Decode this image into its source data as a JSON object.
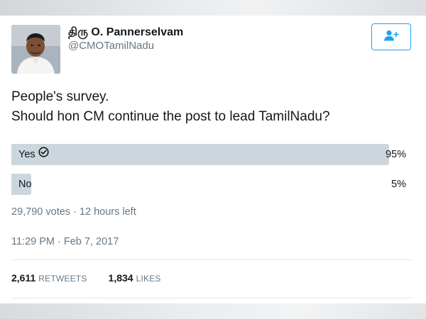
{
  "user": {
    "display_name": "திரு O. Pannerselvam",
    "handle": "@CMOTamilNadu",
    "avatar_icon": "profile-photo"
  },
  "follow_button": {
    "icon": "add-user-icon",
    "accent": "#1da1f2"
  },
  "tweet": {
    "line1": "People's survey.",
    "line2": "Should hon CM continue the post to lead TamilNadu?"
  },
  "poll": {
    "options": [
      {
        "label": "Yes",
        "percent_text": "95%",
        "percent": 95,
        "selected": true
      },
      {
        "label": "No",
        "percent_text": "5%",
        "percent": 5,
        "selected": false
      }
    ],
    "meta": "29,790 votes · 12 hours left",
    "bar_color": "#ccd6dd"
  },
  "timestamp": "11:29 PM · Feb 7, 2017",
  "stats": {
    "retweets_count": "2,611",
    "retweets_label": "RETWEETS",
    "likes_count": "1,834",
    "likes_label": "LIKES"
  }
}
